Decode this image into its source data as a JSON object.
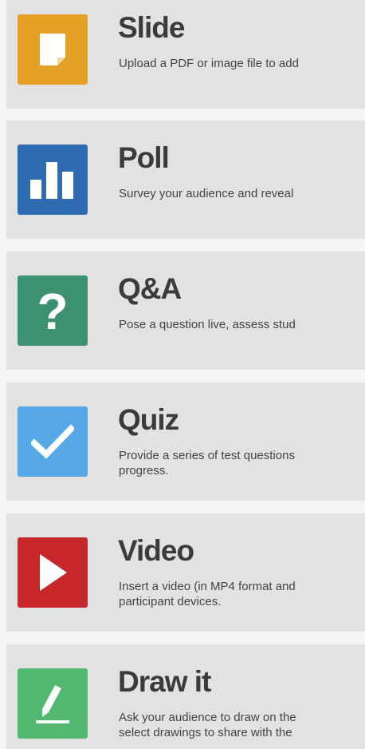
{
  "items": [
    {
      "title": "Slide",
      "desc_line1": "Upload a PDF or image file to add",
      "desc_line2": "",
      "color": "#e5a026",
      "icon": "document-icon"
    },
    {
      "title": "Poll",
      "desc_line1": "Survey your audience and reveal",
      "desc_line2": "",
      "color": "#2f6bb0",
      "icon": "bar-chart-icon"
    },
    {
      "title": "Q&A",
      "desc_line1": "Pose a question live, assess stud",
      "desc_line2": "",
      "color": "#3b9170",
      "icon": "question-mark-icon"
    },
    {
      "title": "Quiz",
      "desc_line1": "Provide a series of test questions",
      "desc_line2": "progress.",
      "color": "#56a7e6",
      "icon": "checkmark-icon"
    },
    {
      "title": "Video",
      "desc_line1": "Insert a video (in MP4 format and",
      "desc_line2": "participant devices.",
      "color": "#c7272a",
      "icon": "play-icon"
    },
    {
      "title": "Draw it",
      "desc_line1": "Ask your audience to draw on the",
      "desc_line2": "select drawings to share with the",
      "color": "#52b86f",
      "icon": "pencil-icon"
    }
  ]
}
